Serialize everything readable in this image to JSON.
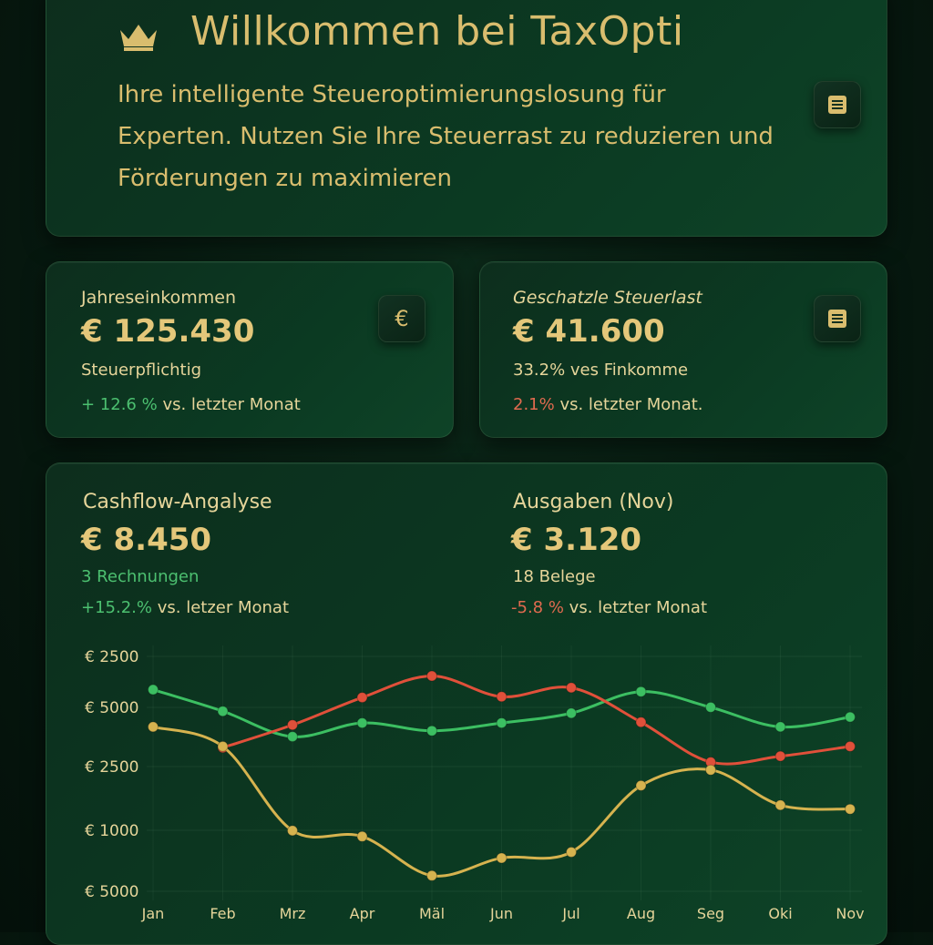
{
  "hero": {
    "title": "Willkommen bei TaxOpti",
    "subtitle": "Ihre intelligente Steueroptimierungslosung für Experten. Nutzen Sie Ihre Steuerrast zu reduzieren und Förderungen zu maximieren",
    "crown_icon": "crown-icon",
    "menu_icon": "document-icon"
  },
  "income": {
    "label": "Jahreseinkommen",
    "value": "€ 125.430",
    "sub": "Steuerpflichtig",
    "delta": "+ 12.6 %",
    "delta_suffix": " vs. letzter Monat",
    "icon": "€"
  },
  "tax": {
    "label": "Geschatzle Steuerlast",
    "value": "€ 41.600",
    "sub": "33.2% ves Finkomme",
    "delta": "2.1%",
    "delta_suffix": " vs. letzter Monat.",
    "icon": "document-icon"
  },
  "cashflow": {
    "label": "Cashflow-Angalyse",
    "value": "€ 8.450",
    "sub": "3 Rechnungen",
    "delta": "+15.2.%",
    "delta_suffix": " vs. letzer Monat"
  },
  "expenses": {
    "label": "Ausgaben (Nov)",
    "value": "€ 3.120",
    "sub": "18 Belege",
    "delta": "-5.8 %",
    "delta_suffix": " vs. letzter Monat"
  },
  "colors": {
    "gold": "#d9bd6e",
    "green": "#3cbf62",
    "red": "#e0503a",
    "yellow": "#d6b34f"
  },
  "chart_data": {
    "type": "line",
    "categories": [
      "Jan",
      "Feb",
      "Mrz",
      "Apr",
      "Mäl",
      "Jun",
      "Jul",
      "Aug",
      "Seg",
      "Oki",
      "Nov"
    ],
    "y_ticks": [
      "€ 2500",
      "€ 5000",
      "€ 2500",
      "€ 1000",
      "€ 5000"
    ],
    "grid": true,
    "legend": "none",
    "series": [
      {
        "color": "green",
        "points": [
          [
            0,
            5.15
          ],
          [
            1,
            4.6
          ],
          [
            2,
            3.95
          ],
          [
            3,
            4.3
          ],
          [
            4,
            4.1
          ],
          [
            5,
            4.3
          ],
          [
            6,
            4.55
          ],
          [
            7,
            5.1
          ],
          [
            8,
            4.7
          ],
          [
            9,
            4.2
          ],
          [
            10,
            4.45
          ]
        ]
      },
      {
        "color": "red",
        "points": [
          [
            1,
            3.67
          ],
          [
            2,
            4.25
          ],
          [
            3,
            4.95
          ],
          [
            4,
            5.5
          ],
          [
            5,
            4.97
          ],
          [
            6,
            5.2
          ],
          [
            7,
            4.32
          ],
          [
            8,
            3.3
          ],
          [
            9,
            3.45
          ],
          [
            10,
            3.7
          ]
        ]
      },
      {
        "color": "yellow",
        "points": [
          [
            0,
            4.2
          ],
          [
            1,
            3.7
          ],
          [
            2,
            1.55
          ],
          [
            3,
            1.4
          ],
          [
            4,
            0.4
          ],
          [
            5,
            0.85
          ],
          [
            6,
            1.0
          ],
          [
            7,
            2.7
          ],
          [
            8,
            3.1
          ],
          [
            9,
            2.2
          ],
          [
            10,
            2.1
          ]
        ]
      }
    ]
  }
}
